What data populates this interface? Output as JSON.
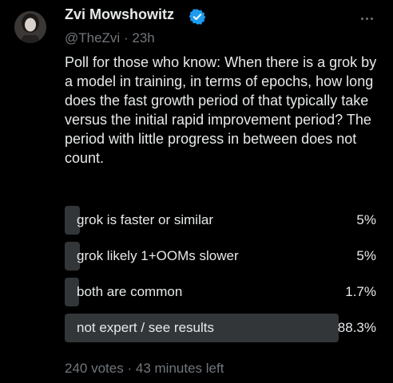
{
  "author": {
    "display_name": "Zvi Mowshowitz",
    "handle": "@TheZvi",
    "separator": "·",
    "time_ago": "23h",
    "verified": true,
    "verified_color": "#1d9bf0"
  },
  "post": {
    "text": "Poll for those who know: When there is a grok by a model in training, in terms of epochs, how long does the fast growth period of that typically take versus the initial rapid improvement period? The period with little progress in between does not count."
  },
  "poll": {
    "options": [
      {
        "label": "grok is faster or similar",
        "percent_text": "5%",
        "percent": 5.0
      },
      {
        "label": "grok likely 1+OOMs slower",
        "percent_text": "5%",
        "percent": 5.0
      },
      {
        "label": "both are common",
        "percent_text": "1.7%",
        "percent": 1.7
      },
      {
        "label": "not expert / see results",
        "percent_text": "88.3%",
        "percent": 88.3
      }
    ],
    "votes_text": "240 votes",
    "separator": "·",
    "time_left": "43 minutes left"
  },
  "icons": {
    "more": "more-horizontal-icon",
    "verified": "verified-badge-icon"
  },
  "colors": {
    "background": "#000000",
    "text": "#e7e9ea",
    "muted": "#71767b",
    "poll_bar": "#333639"
  }
}
